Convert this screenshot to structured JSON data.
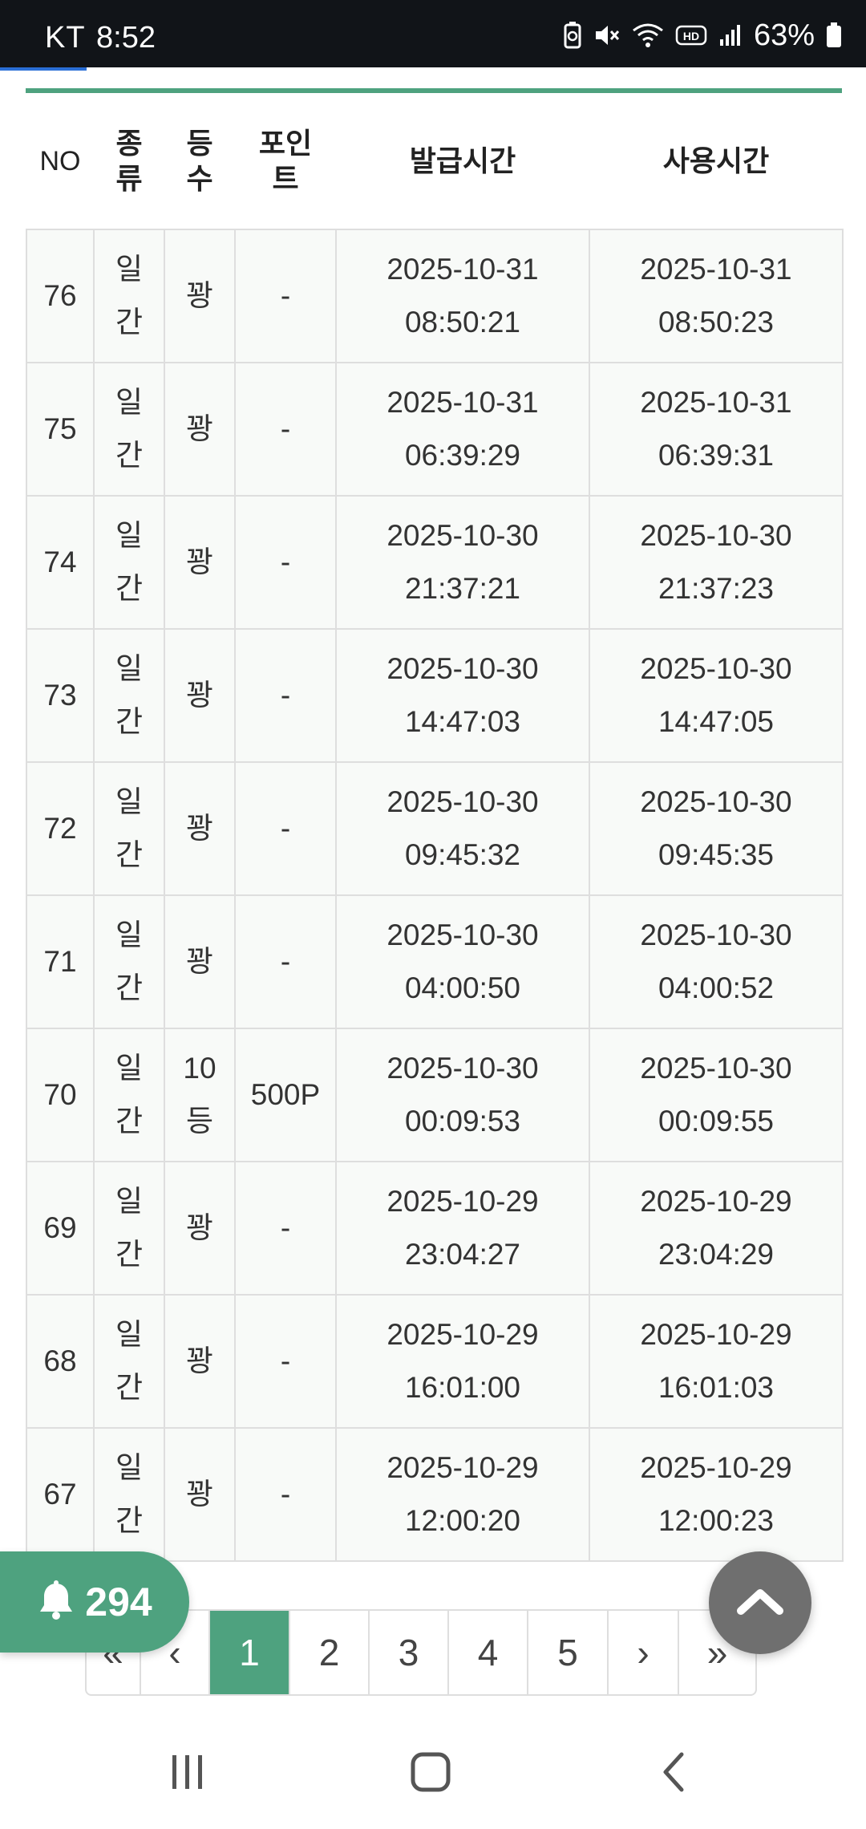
{
  "status_bar": {
    "carrier": "KT",
    "time": "8:52",
    "battery_percent": "63%",
    "icons": [
      "battery-saver-icon",
      "mute-icon",
      "wifi-icon",
      "hd-voice-icon",
      "signal-icon",
      "battery-icon"
    ]
  },
  "table": {
    "accent_color": "#4ea27f",
    "headers": {
      "no": "NO",
      "kind_1": "종",
      "kind_2": "류",
      "grade_1": "등",
      "grade_2": "수",
      "point_1": "포인",
      "point_2": "트",
      "issued": "발급시간",
      "used": "사용시간"
    },
    "rows": [
      {
        "no": "76",
        "kind_1": "일",
        "kind_2": "간",
        "grade_1": "꽝",
        "grade_2": "",
        "point": "-",
        "issued_date": "2025-10-31",
        "issued_time": "08:50:21",
        "used_date": "2025-10-31",
        "used_time": "08:50:23"
      },
      {
        "no": "75",
        "kind_1": "일",
        "kind_2": "간",
        "grade_1": "꽝",
        "grade_2": "",
        "point": "-",
        "issued_date": "2025-10-31",
        "issued_time": "06:39:29",
        "used_date": "2025-10-31",
        "used_time": "06:39:31"
      },
      {
        "no": "74",
        "kind_1": "일",
        "kind_2": "간",
        "grade_1": "꽝",
        "grade_2": "",
        "point": "-",
        "issued_date": "2025-10-30",
        "issued_time": "21:37:21",
        "used_date": "2025-10-30",
        "used_time": "21:37:23"
      },
      {
        "no": "73",
        "kind_1": "일",
        "kind_2": "간",
        "grade_1": "꽝",
        "grade_2": "",
        "point": "-",
        "issued_date": "2025-10-30",
        "issued_time": "14:47:03",
        "used_date": "2025-10-30",
        "used_time": "14:47:05"
      },
      {
        "no": "72",
        "kind_1": "일",
        "kind_2": "간",
        "grade_1": "꽝",
        "grade_2": "",
        "point": "-",
        "issued_date": "2025-10-30",
        "issued_time": "09:45:32",
        "used_date": "2025-10-30",
        "used_time": "09:45:35"
      },
      {
        "no": "71",
        "kind_1": "일",
        "kind_2": "간",
        "grade_1": "꽝",
        "grade_2": "",
        "point": "-",
        "issued_date": "2025-10-30",
        "issued_time": "04:00:50",
        "used_date": "2025-10-30",
        "used_time": "04:00:52"
      },
      {
        "no": "70",
        "kind_1": "일",
        "kind_2": "간",
        "grade_1": "10",
        "grade_2": "등",
        "point": "500P",
        "issued_date": "2025-10-30",
        "issued_time": "00:09:53",
        "used_date": "2025-10-30",
        "used_time": "00:09:55"
      },
      {
        "no": "69",
        "kind_1": "일",
        "kind_2": "간",
        "grade_1": "꽝",
        "grade_2": "",
        "point": "-",
        "issued_date": "2025-10-29",
        "issued_time": "23:04:27",
        "used_date": "2025-10-29",
        "used_time": "23:04:29"
      },
      {
        "no": "68",
        "kind_1": "일",
        "kind_2": "간",
        "grade_1": "꽝",
        "grade_2": "",
        "point": "-",
        "issued_date": "2025-10-29",
        "issued_time": "16:01:00",
        "used_date": "2025-10-29",
        "used_time": "16:01:03"
      },
      {
        "no": "67",
        "kind_1": "일",
        "kind_2": "간",
        "grade_1": "꽝",
        "grade_2": "",
        "point": "-",
        "issued_date": "2025-10-29",
        "issued_time": "12:00:20",
        "used_date": "2025-10-29",
        "used_time": "12:00:23"
      }
    ]
  },
  "pagination": {
    "first": "«",
    "prev": "‹",
    "pages": [
      "1",
      "2",
      "3",
      "4",
      "5"
    ],
    "active_page": "1",
    "next": "›",
    "last": "»"
  },
  "notification": {
    "icon": "bell-icon",
    "count": "294"
  },
  "scroll_top": {
    "icon": "chevron-up-icon"
  },
  "nav_bar": {
    "icons": [
      "recent-apps-icon",
      "home-icon",
      "back-icon"
    ]
  }
}
